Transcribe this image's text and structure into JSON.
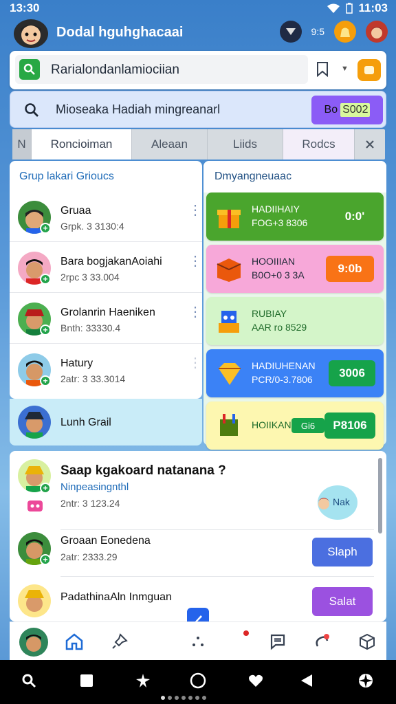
{
  "status": {
    "time": "13:30",
    "battery": "11:03"
  },
  "app": {
    "title": "Dodal hguhghacaai",
    "badge_count": "9:5"
  },
  "search": {
    "value": "Rarialondanlamiociian"
  },
  "promo": {
    "text": "Mioseaka Hadiah mingreanarl",
    "btn_prefix": "Bo",
    "btn_value": "S002"
  },
  "tabs": [
    "Roncioiman",
    "Aleaan",
    "Liids",
    "Rodcs"
  ],
  "tab_prefix": "N",
  "group": {
    "title": "Grup lakari Grioucs",
    "contacts": [
      {
        "name": "Gruaa",
        "sub": "Grpk. 3 3130:4"
      },
      {
        "name": "Bara bogjakanAoiahi",
        "sub": "2rpc 3 33.004"
      },
      {
        "name": "Grolanrin Haeniken",
        "sub": "Bnth: 33330.4"
      },
      {
        "name": "Hatury",
        "sub": "2atr: 3 33.3014"
      }
    ],
    "footer_name": "Lunh Grail"
  },
  "offers": {
    "title": "Dmyangneuaac",
    "items": [
      {
        "t1": "HADIIHAIY",
        "t2": "FOG+3 8306",
        "pill": "0:0'",
        "bg": "#4aa52d",
        "fg": "#ffffff"
      },
      {
        "t1": "HOOIIIAN",
        "t2": "B0O+0 3 3A",
        "pill": "9:0b",
        "bg": "#f7a8d9",
        "fg": "#1f2937"
      },
      {
        "t1": "RUBIAY",
        "t2": "AAR ro 8529",
        "pill": "",
        "bg": "#d4f5c9",
        "fg": "#1f6b2a"
      },
      {
        "t1": "HADIUHENAN",
        "t2": "PCR/0-3.7806",
        "pill": "3006",
        "bg": "#3b82f6",
        "fg": "#ffffff"
      },
      {
        "t1": "HOIIKAN",
        "t2": "",
        "pill": "P8106",
        "tag": "Gi6",
        "bg": "#fdf7b0",
        "fg": "#1f6b2a"
      }
    ]
  },
  "feed": {
    "title": "Saap kgakoard natanana ?",
    "subtitle": "Ninpeasingnthl",
    "date1": "2ntr: 3 123.24",
    "side_badge": "Nak",
    "items": [
      {
        "name": "Groaan Eonedena",
        "sub": "2atr: 2333.29",
        "btn": "Slaph",
        "btn_color": "#4b6fe0"
      },
      {
        "name": "PadathinaAln Inmguan",
        "sub": "",
        "btn": "Salat",
        "btn_color": "#9b51e0"
      }
    ]
  }
}
